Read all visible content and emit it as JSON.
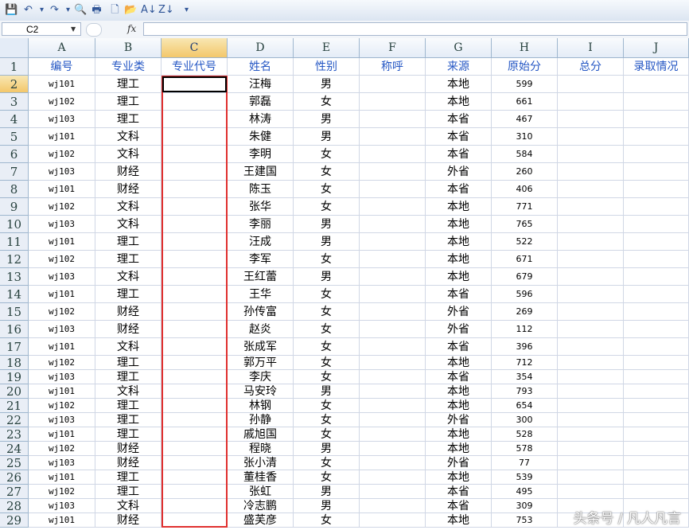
{
  "toolbar": {
    "icons": [
      "save-icon",
      "undo-icon",
      "undo-dropdown-icon",
      "redo-icon",
      "redo-dropdown-icon",
      "print-preview-icon",
      "print-icon",
      "new-file-icon",
      "open-folder-icon",
      "sort-ascending-icon",
      "sort-descending-icon",
      "customize-toolbar-icon"
    ],
    "glyphs": [
      "💾",
      "↶",
      "▾",
      "↷",
      "▾",
      "🔍",
      "🖶",
      "🗋",
      "📂",
      "A↓",
      "Z↓",
      "▾"
    ]
  },
  "formula_bar": {
    "name_box": "C2",
    "fx_label": "fx",
    "value": ""
  },
  "columns": [
    "A",
    "B",
    "C",
    "D",
    "E",
    "F",
    "G",
    "H",
    "I",
    "J"
  ],
  "selected_column": "C",
  "selected_row": 2,
  "headers": [
    "编号",
    "专业类",
    "专业代号",
    "姓名",
    "性别",
    "称呼",
    "来源",
    "原始分",
    "总分",
    "录取情况"
  ],
  "rows": [
    {
      "num": "2",
      "id": "wj101",
      "cat": "理工",
      "code": "",
      "name": "汪梅",
      "sex": "男",
      "title": "",
      "src": "本地",
      "score": "599",
      "total": "",
      "result": ""
    },
    {
      "num": "3",
      "id": "wj102",
      "cat": "理工",
      "code": "",
      "name": "郭磊",
      "sex": "女",
      "title": "",
      "src": "本地",
      "score": "661",
      "total": "",
      "result": ""
    },
    {
      "num": "4",
      "id": "wj103",
      "cat": "理工",
      "code": "",
      "name": "林涛",
      "sex": "男",
      "title": "",
      "src": "本省",
      "score": "467",
      "total": "",
      "result": ""
    },
    {
      "num": "5",
      "id": "wj101",
      "cat": "文科",
      "code": "",
      "name": "朱健",
      "sex": "男",
      "title": "",
      "src": "本省",
      "score": "310",
      "total": "",
      "result": ""
    },
    {
      "num": "6",
      "id": "wj102",
      "cat": "文科",
      "code": "",
      "name": "李明",
      "sex": "女",
      "title": "",
      "src": "本省",
      "score": "584",
      "total": "",
      "result": ""
    },
    {
      "num": "7",
      "id": "wj103",
      "cat": "财经",
      "code": "",
      "name": "王建国",
      "sex": "女",
      "title": "",
      "src": "外省",
      "score": "260",
      "total": "",
      "result": ""
    },
    {
      "num": "8",
      "id": "wj101",
      "cat": "财经",
      "code": "",
      "name": "陈玉",
      "sex": "女",
      "title": "",
      "src": "本省",
      "score": "406",
      "total": "",
      "result": ""
    },
    {
      "num": "9",
      "id": "wj102",
      "cat": "文科",
      "code": "",
      "name": "张华",
      "sex": "女",
      "title": "",
      "src": "本地",
      "score": "771",
      "total": "",
      "result": ""
    },
    {
      "num": "10",
      "id": "wj103",
      "cat": "文科",
      "code": "",
      "name": "李丽",
      "sex": "男",
      "title": "",
      "src": "本地",
      "score": "765",
      "total": "",
      "result": ""
    },
    {
      "num": "11",
      "id": "wj101",
      "cat": "理工",
      "code": "",
      "name": "汪成",
      "sex": "男",
      "title": "",
      "src": "本地",
      "score": "522",
      "total": "",
      "result": ""
    },
    {
      "num": "12",
      "id": "wj102",
      "cat": "理工",
      "code": "",
      "name": "李军",
      "sex": "女",
      "title": "",
      "src": "本地",
      "score": "671",
      "total": "",
      "result": ""
    },
    {
      "num": "13",
      "id": "wj103",
      "cat": "文科",
      "code": "",
      "name": "王红蕾",
      "sex": "男",
      "title": "",
      "src": "本地",
      "score": "679",
      "total": "",
      "result": ""
    },
    {
      "num": "14",
      "id": "wj101",
      "cat": "理工",
      "code": "",
      "name": "王华",
      "sex": "女",
      "title": "",
      "src": "本省",
      "score": "596",
      "total": "",
      "result": ""
    },
    {
      "num": "15",
      "id": "wj102",
      "cat": "财经",
      "code": "",
      "name": "孙传富",
      "sex": "女",
      "title": "",
      "src": "外省",
      "score": "269",
      "total": "",
      "result": ""
    },
    {
      "num": "16",
      "id": "wj103",
      "cat": "财经",
      "code": "",
      "name": "赵炎",
      "sex": "女",
      "title": "",
      "src": "外省",
      "score": "112",
      "total": "",
      "result": ""
    },
    {
      "num": "17",
      "id": "wj101",
      "cat": "文科",
      "code": "",
      "name": "张成军",
      "sex": "女",
      "title": "",
      "src": "本省",
      "score": "396",
      "total": "",
      "result": ""
    },
    {
      "num": "18",
      "id": "wj102",
      "cat": "理工",
      "code": "",
      "name": "郭万平",
      "sex": "女",
      "title": "",
      "src": "本地",
      "score": "712",
      "total": "",
      "result": ""
    },
    {
      "num": "19",
      "id": "wj103",
      "cat": "理工",
      "code": "",
      "name": "李庆",
      "sex": "女",
      "title": "",
      "src": "本省",
      "score": "354",
      "total": "",
      "result": ""
    },
    {
      "num": "20",
      "id": "wj101",
      "cat": "文科",
      "code": "",
      "name": "马安玲",
      "sex": "男",
      "title": "",
      "src": "本地",
      "score": "793",
      "total": "",
      "result": ""
    },
    {
      "num": "21",
      "id": "wj102",
      "cat": "理工",
      "code": "",
      "name": "林钢",
      "sex": "女",
      "title": "",
      "src": "本地",
      "score": "654",
      "total": "",
      "result": ""
    },
    {
      "num": "22",
      "id": "wj103",
      "cat": "理工",
      "code": "",
      "name": "孙静",
      "sex": "女",
      "title": "",
      "src": "外省",
      "score": "300",
      "total": "",
      "result": ""
    },
    {
      "num": "23",
      "id": "wj101",
      "cat": "理工",
      "code": "",
      "name": "戚旭国",
      "sex": "女",
      "title": "",
      "src": "本地",
      "score": "528",
      "total": "",
      "result": ""
    },
    {
      "num": "24",
      "id": "wj102",
      "cat": "财经",
      "code": "",
      "name": "程晓",
      "sex": "男",
      "title": "",
      "src": "本地",
      "score": "578",
      "total": "",
      "result": ""
    },
    {
      "num": "25",
      "id": "wj103",
      "cat": "财经",
      "code": "",
      "name": "张小清",
      "sex": "女",
      "title": "",
      "src": "外省",
      "score": "77",
      "total": "",
      "result": ""
    },
    {
      "num": "26",
      "id": "wj101",
      "cat": "理工",
      "code": "",
      "name": "董桂香",
      "sex": "女",
      "title": "",
      "src": "本地",
      "score": "539",
      "total": "",
      "result": ""
    },
    {
      "num": "27",
      "id": "wj102",
      "cat": "理工",
      "code": "",
      "name": "张虹",
      "sex": "男",
      "title": "",
      "src": "本省",
      "score": "495",
      "total": "",
      "result": ""
    },
    {
      "num": "28",
      "id": "wj103",
      "cat": "文科",
      "code": "",
      "name": "冷志鹏",
      "sex": "男",
      "title": "",
      "src": "本省",
      "score": "309",
      "total": "",
      "result": ""
    },
    {
      "num": "29",
      "id": "wj101",
      "cat": "财经",
      "code": "",
      "name": "盛芙彦",
      "sex": "女",
      "title": "",
      "src": "本地",
      "score": "753",
      "total": "",
      "result": ""
    }
  ],
  "header_row_num": "1",
  "watermark": "头条号 / 凡人凡言",
  "colors": {
    "header_text": "#2557c4",
    "highlight_border": "#e0302f",
    "selected_header": "#f3c76a"
  }
}
